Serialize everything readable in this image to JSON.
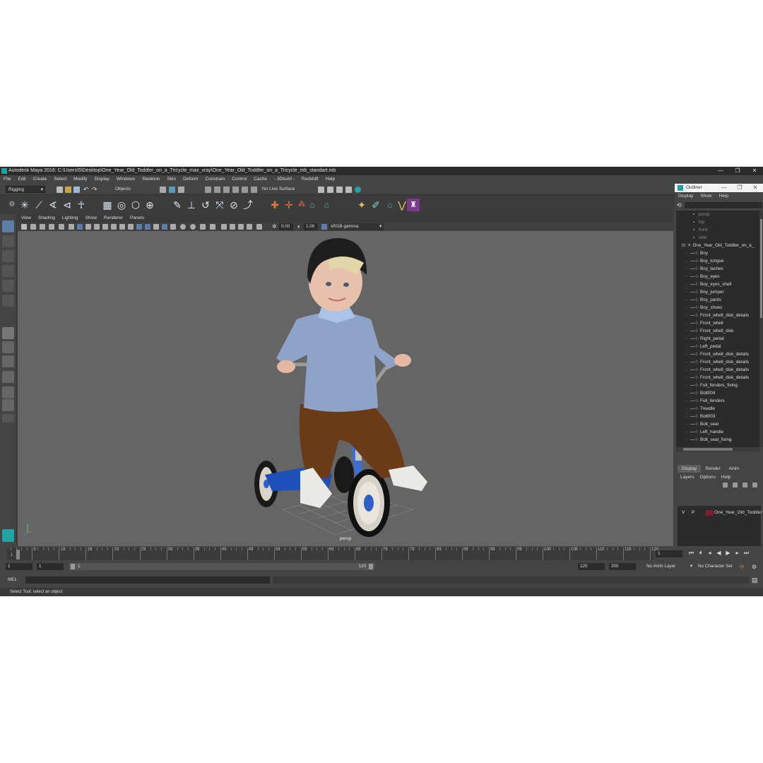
{
  "window": {
    "title": "Autodesk Maya 2016: C:\\Users\\5\\Desktop\\One_Year_Old_Toddler_on_a_Tricycle_max_vray\\One_Year_Old_Toddler_on_a_Tricycle_mb_standart.mb",
    "controls": [
      "—",
      "❐",
      "✕"
    ]
  },
  "menubar": [
    "File",
    "Edit",
    "Create",
    "Select",
    "Modify",
    "Display",
    "Windows",
    "Skeleton",
    "Skin",
    "Deform",
    "Constrain",
    "Control",
    "Cache",
    "- 3DtoAll -",
    "Redshift",
    "Help"
  ],
  "statusline": {
    "menuset": "Rigging",
    "selection_mode": "Objects",
    "live_surface": "No Live Surface"
  },
  "viewport": {
    "menus": [
      "View",
      "Shading",
      "Lighting",
      "Show",
      "Renderer",
      "Panels"
    ],
    "exposure": "0.00",
    "gamma": "1.00",
    "color_space": "sRGB gamma",
    "camera_label": "persp"
  },
  "outliner": {
    "title": "Outliner",
    "menus": [
      "Display",
      "Show",
      "Help"
    ],
    "cameras": [
      "persp",
      "top",
      "front",
      "side"
    ],
    "root": "One_Year_Old_Toddler_on_a_",
    "items": [
      "Boy",
      "Boy_tongue",
      "Boy_lashes",
      "Boy_eyes",
      "Boy_eyes_shell",
      "Boy_jumper",
      "Boy_pants",
      "Boy_shoes",
      "Front_whell_disk_details",
      "Front_whell",
      "Front_whell_disk",
      "Right_pedal",
      "Left_pedal",
      "Front_whell_disk_details",
      "Front_whell_disk_details",
      "Front_whell_disk_details",
      "Front_whell_disk_details",
      "Full_fenders_fixing",
      "Bolt004",
      "Full_fenders",
      "Treadle",
      "Bolt003",
      "Bolt_seat",
      "Left_handle",
      "Bolt_seat_fixing"
    ]
  },
  "layer_editor": {
    "tabs": [
      "Display",
      "Render",
      "Anim"
    ],
    "menus": [
      "Layers",
      "Options",
      "Help"
    ],
    "layer": {
      "v": "V",
      "p": "P",
      "name": "One_Year_Old_Toddler",
      "color": "#8b1a2a"
    }
  },
  "timeline": {
    "ticks": [
      "5",
      "10",
      "15",
      "20",
      "25",
      "30",
      "35",
      "40",
      "45",
      "50",
      "55",
      "60",
      "65",
      "70",
      "75",
      "80",
      "85",
      "90",
      "95",
      "100",
      "105",
      "110",
      "115",
      "120"
    ],
    "current_frame": "1",
    "start_marker": "1"
  },
  "range": {
    "start": "1",
    "playback_start": "1",
    "slider_start": "1",
    "slider_end": "120",
    "playback_end": "120",
    "end": "200",
    "anim_layer": "No Anim Layer",
    "char_set": "No Character Set"
  },
  "command": {
    "lang": "MEL"
  },
  "help_line": "Select Tool: select an object",
  "colors": {
    "accent": "#1fa3a3",
    "viewport_bg": "#656565",
    "panel_bg": "#444444"
  }
}
